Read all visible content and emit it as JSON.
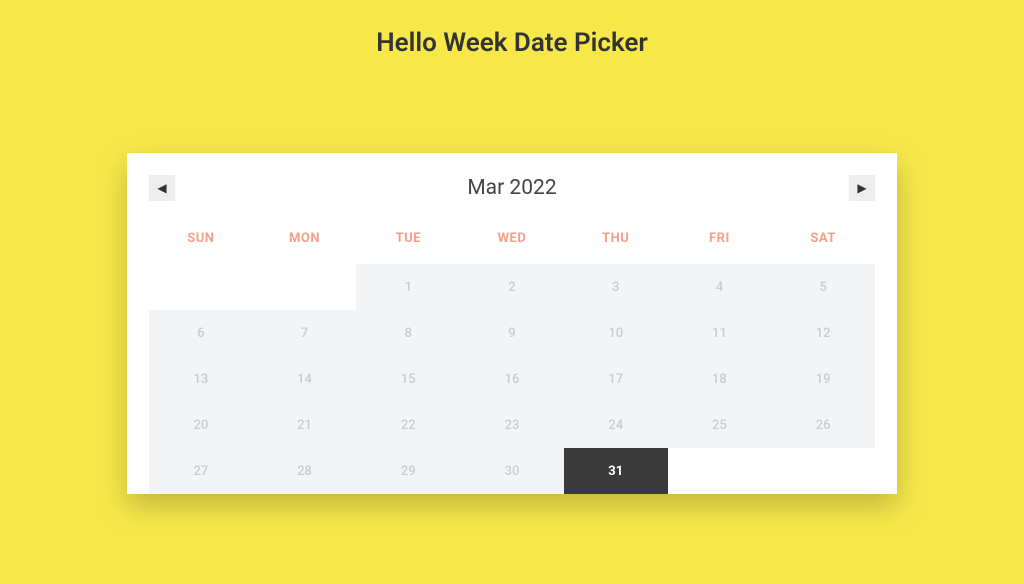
{
  "title": "Hello Week Date Picker",
  "calendar": {
    "month_label": "Mar 2022",
    "weekdays": [
      "SUN",
      "MON",
      "TUE",
      "WED",
      "THU",
      "FRI",
      "SAT"
    ],
    "days": [
      {
        "n": "",
        "state": "empty"
      },
      {
        "n": "",
        "state": "empty"
      },
      {
        "n": "1",
        "state": "disabled"
      },
      {
        "n": "2",
        "state": "disabled"
      },
      {
        "n": "3",
        "state": "disabled"
      },
      {
        "n": "4",
        "state": "disabled"
      },
      {
        "n": "5",
        "state": "disabled"
      },
      {
        "n": "6",
        "state": "disabled"
      },
      {
        "n": "7",
        "state": "disabled"
      },
      {
        "n": "8",
        "state": "disabled"
      },
      {
        "n": "9",
        "state": "disabled"
      },
      {
        "n": "10",
        "state": "disabled"
      },
      {
        "n": "11",
        "state": "disabled"
      },
      {
        "n": "12",
        "state": "disabled"
      },
      {
        "n": "13",
        "state": "disabled"
      },
      {
        "n": "14",
        "state": "disabled"
      },
      {
        "n": "15",
        "state": "disabled"
      },
      {
        "n": "16",
        "state": "disabled"
      },
      {
        "n": "17",
        "state": "disabled"
      },
      {
        "n": "18",
        "state": "disabled"
      },
      {
        "n": "19",
        "state": "disabled"
      },
      {
        "n": "20",
        "state": "disabled"
      },
      {
        "n": "21",
        "state": "disabled"
      },
      {
        "n": "22",
        "state": "disabled"
      },
      {
        "n": "23",
        "state": "disabled"
      },
      {
        "n": "24",
        "state": "disabled"
      },
      {
        "n": "25",
        "state": "disabled"
      },
      {
        "n": "26",
        "state": "disabled"
      },
      {
        "n": "27",
        "state": "disabled"
      },
      {
        "n": "28",
        "state": "disabled"
      },
      {
        "n": "29",
        "state": "disabled"
      },
      {
        "n": "30",
        "state": "disabled"
      },
      {
        "n": "31",
        "state": "selected"
      },
      {
        "n": "",
        "state": "empty"
      },
      {
        "n": "",
        "state": "empty"
      }
    ]
  },
  "nav": {
    "prev": "◀",
    "next": "▶"
  }
}
